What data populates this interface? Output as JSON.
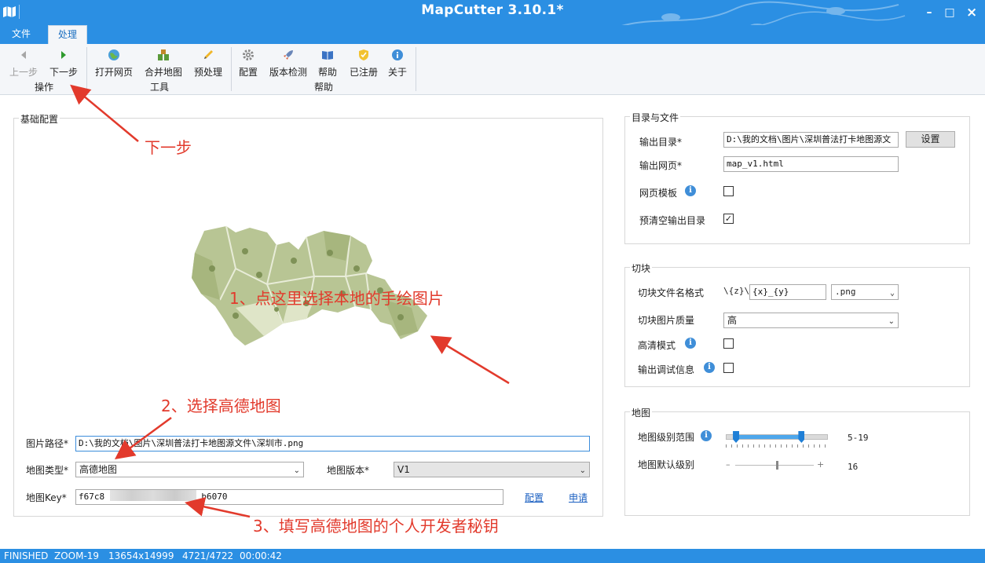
{
  "window": {
    "title": "MapCutter 3.10.1*",
    "minimize_glyph": "–",
    "maximize_glyph": "□",
    "close_glyph": "×"
  },
  "menu": {
    "tabs": [
      {
        "label": "文件"
      },
      {
        "label": "处理"
      }
    ]
  },
  "ribbon": {
    "buttons": {
      "prev": "上一步",
      "next": "下一步",
      "open_web": "打开网页",
      "merge_map": "合并地图",
      "preprocess": "预处理",
      "config": "配置",
      "version_check": "版本检测",
      "help": "帮助",
      "registered": "已注册",
      "about": "关于"
    },
    "groups": {
      "operation": "操作",
      "tools": "工具",
      "help": "帮助"
    }
  },
  "basic": {
    "legend": "基础配置",
    "image_path_label": "图片路径*",
    "image_path_value": "D:\\我的文档\\图片\\深圳普法打卡地图源文件\\深圳市.png",
    "map_type_label": "地图类型*",
    "map_type_value": "高德地图",
    "map_version_label": "地图版本*",
    "map_version_value": "V1",
    "map_key_label": "地图Key*",
    "map_key_prefix": "f67c8",
    "map_key_suffix": "b6070",
    "config_link": "配置",
    "apply_link": "申请"
  },
  "dirs": {
    "legend": "目录与文件",
    "output_dir_label": "输出目录*",
    "output_dir_value": "D:\\我的文档\\图片\\深圳普法打卡地图源文",
    "set_button": "设置",
    "output_page_label": "输出网页*",
    "output_page_value": "map_v1.html",
    "template_label": "网页模板",
    "clear_label": "预清空输出目录",
    "template_checked": false,
    "clear_checked": true
  },
  "tile": {
    "legend": "切块",
    "name_format_label": "切块文件名格式",
    "name_format_prefix": "\\{z}\\",
    "name_format_value": "{x}_{y}",
    "ext_value": ".png",
    "quality_label": "切块图片质量",
    "quality_value": "高",
    "hd_label": "高清模式",
    "debug_label": "输出调试信息"
  },
  "mapsec": {
    "legend": "地图",
    "zoom_range_label": "地图级别范围",
    "zoom_range_value": "5-19",
    "zoom_range_min": 5,
    "zoom_range_max": 19,
    "default_zoom_label": "地图默认级别",
    "default_zoom_value": "16",
    "minus_glyph": "–",
    "plus_glyph": "+"
  },
  "annotations": {
    "next": "下一步",
    "step1": "1、点这里选择本地的手绘图片",
    "step2": "2、选择高德地图",
    "step3": "3、填写高德地图的个人开发者秘钥"
  },
  "status": {
    "state": "FINISHED",
    "zoom": "ZOOM-19",
    "size": "13654x14999",
    "progress": "4721/4722",
    "time": "00:00:42"
  },
  "colors": {
    "accent": "#2b8fe3",
    "annotation": "#e23a2c",
    "map_fill": "#b8c594"
  }
}
